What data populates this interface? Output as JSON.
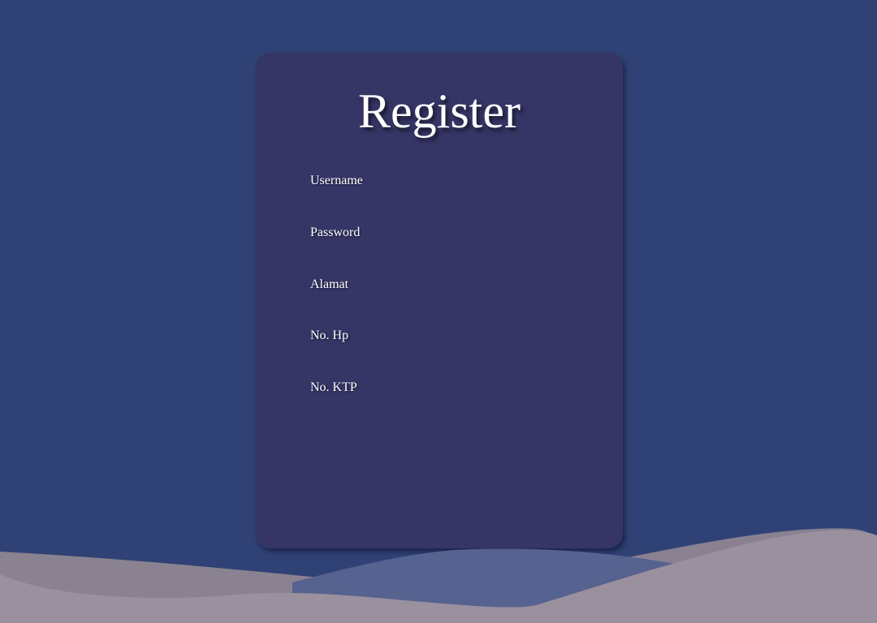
{
  "register_form": {
    "title": "Register",
    "fields": [
      {
        "label": "Username"
      },
      {
        "label": "Password"
      },
      {
        "label": "Alamat"
      },
      {
        "label": "No. Hp"
      },
      {
        "label": "No. KTP"
      }
    ]
  },
  "colors": {
    "background": "#304275",
    "card": "#353566",
    "wave_gray": "#9a909e",
    "wave_blue": "#56628f"
  }
}
